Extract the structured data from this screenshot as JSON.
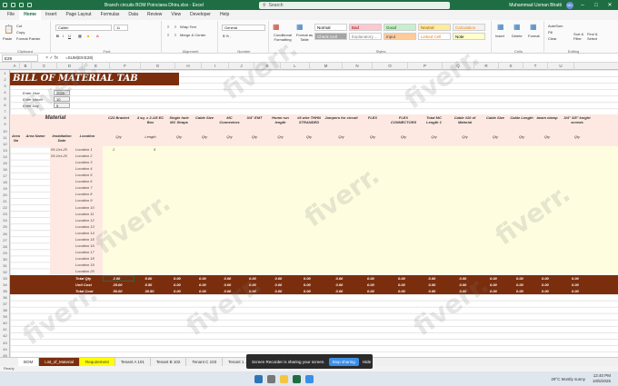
{
  "window": {
    "file_title": "Branch circuits BOM Poinciana  Dhiru.xlsx  -  Excel",
    "search_placeholder": "Search",
    "user_name": "Muhammad Usman Bhatti",
    "user_initials": "MU"
  },
  "menu": [
    "File",
    "Home",
    "Insert",
    "Page Layout",
    "Formulas",
    "Data",
    "Review",
    "View",
    "Developer",
    "Help"
  ],
  "ribbon": {
    "clipboard": {
      "paste": "Paste",
      "cut": "Cut",
      "copy": "Copy",
      "format_painter": "Format Painter",
      "label": "Clipboard"
    },
    "font": {
      "name": "Calibri",
      "size": "11",
      "label": "Font"
    },
    "alignment": {
      "wrap": "Wrap Text",
      "merge": "Merge & Center",
      "label": "Alignment"
    },
    "number": {
      "format": "General",
      "label": "Number"
    },
    "styles": {
      "conditional": "Conditional Formatting",
      "format_table": "Format as Table",
      "cells": [
        {
          "text": "Normal",
          "bg": "#ffffff",
          "fg": "#000000"
        },
        {
          "text": "Bad",
          "bg": "#ffc7ce",
          "fg": "#9c0006"
        },
        {
          "text": "Good",
          "bg": "#c6efce",
          "fg": "#006100"
        },
        {
          "text": "Neutral",
          "bg": "#ffeb9c",
          "fg": "#9c5700"
        },
        {
          "text": "Calculation",
          "bg": "#f2f2f2",
          "fg": "#fa7d00"
        },
        {
          "text": "Check Cell",
          "bg": "#a5a5a5",
          "fg": "#ffffff"
        },
        {
          "text": "Explanatory ...",
          "bg": "#ffffff",
          "fg": "#7f7f7f"
        },
        {
          "text": "Input",
          "bg": "#ffcc99",
          "fg": "#3f3f76"
        },
        {
          "text": "Linked Cell",
          "bg": "#ffffff",
          "fg": "#fa7d00"
        },
        {
          "text": "Note",
          "bg": "#ffffcc",
          "fg": "#000000"
        }
      ],
      "label": "Styles"
    },
    "cells": {
      "insert": "Insert",
      "delete": "Delete",
      "format": "Format",
      "label": "Cells"
    },
    "editing": {
      "autosum": "AutoSum",
      "fill": "Fill",
      "clear": "Clear",
      "sort": "Sort & Filter",
      "find": "Find & Select",
      "label": "Editing"
    }
  },
  "formula_bar": {
    "name_box": "E29",
    "formula": "=SUM(E9:E28)"
  },
  "columns": [
    "A",
    "B",
    "C",
    "D",
    "E",
    "F",
    "G",
    "H",
    "I",
    "J",
    "K",
    "L",
    "M",
    "N",
    "O",
    "P",
    "Q",
    "R",
    "S",
    "T",
    "U"
  ],
  "rows": [
    "1",
    "2",
    "3",
    "4",
    "5",
    "6",
    "7",
    "8",
    "9",
    "10",
    "11",
    "12",
    "13",
    "14",
    "15",
    "16",
    "17",
    "18",
    "19",
    "20",
    "21",
    "22",
    "23",
    "24",
    "25",
    "26",
    "27",
    "28",
    "29",
    "30",
    "31",
    "32",
    "33",
    "34",
    "35",
    "36",
    "37",
    "38",
    "39",
    "40",
    "41",
    "42",
    "43",
    "44",
    "45"
  ],
  "sheet": {
    "title": "BILL OF MATERIAL TAB",
    "enter_year_label": "Enter Year",
    "enter_year": "2025",
    "enter_month_label": "Enter Month",
    "enter_month": "10",
    "enter_day_label": "Enter Day",
    "enter_day": "5",
    "material_label": "Material",
    "fixed_headers": [
      "Area No",
      "Area Name",
      "Installation Date",
      "Location"
    ],
    "item_headers": [
      {
        "name": "C23 Bracket",
        "unit": "Qty"
      },
      {
        "name": "4 sq. x 2-1/8 EC Box",
        "unit": "Length"
      },
      {
        "name": "Single hole MC Straps",
        "unit": "Qty"
      },
      {
        "name": "Cable Size",
        "unit": "Qty"
      },
      {
        "name": "MC Connectors",
        "unit": "Qty"
      },
      {
        "name": "3/4\" EMT",
        "unit": "Qty"
      },
      {
        "name": "Home run length",
        "unit": "Qty"
      },
      {
        "name": "#6 wire THHN STRANDED",
        "unit": "Qty"
      },
      {
        "name": "Jumpers for circuit",
        "unit": "Qty"
      },
      {
        "name": "FLEX",
        "unit": "Qty"
      },
      {
        "name": "FLEX CONNECTORS",
        "unit": "Qty"
      },
      {
        "name": "Total MC Length 1",
        "unit": "Qty"
      },
      {
        "name": "Cable #10 of Material",
        "unit": "Qty"
      },
      {
        "name": "Cable Size",
        "unit": "Qty"
      },
      {
        "name": "Cable Length",
        "unit": "Qty"
      },
      {
        "name": "beam clamp",
        "unit": "Qty"
      },
      {
        "name": "3/4\" 3/8\" knight screws",
        "unit": "Qty"
      }
    ],
    "dates": [
      "05-Oct-25",
      "05-Oct-25"
    ],
    "first_values": [
      "2",
      "5"
    ],
    "locations": [
      "Location 1",
      "Location 2",
      "Location 3",
      "Location 4",
      "Location 5",
      "Location 6",
      "Location 7",
      "Location 8",
      "Location 9",
      "Location 10",
      "Location 11",
      "Location 12",
      "Location 13",
      "Location 14",
      "Location 15",
      "Location 16",
      "Location 17",
      "Location 18",
      "Location 19",
      "Location 20"
    ],
    "totals": [
      {
        "label": "Total Qty",
        "values": [
          "2.00",
          "5.00",
          "0.00",
          "0.00",
          "0.00",
          "0.00",
          "0.00",
          "0.00",
          "0.00",
          "0.00",
          "0.00",
          "0.00",
          "0.00",
          "0.00",
          "0.00",
          "0.00",
          "0.00"
        ]
      },
      {
        "label": "Unit Cost",
        "values": [
          "25.00",
          "5.50",
          "0.00",
          "0.00",
          "0.00",
          "0.00",
          "0.00",
          "0.00",
          "0.00",
          "0.00",
          "0.00",
          "0.00",
          "0.00",
          "0.00",
          "0.00",
          "0.00",
          "0.00"
        ]
      },
      {
        "label": "Total Cost",
        "values": [
          "50.00",
          "30.50",
          "0.00",
          "0.00",
          "0.00",
          "0.00",
          "0.00",
          "0.00",
          "0.00",
          "0.00",
          "0.00",
          "0.00",
          "0.00",
          "0.00",
          "0.00",
          "0.00",
          "0.00"
        ]
      }
    ]
  },
  "sheet_tabs": [
    {
      "name": "BOM",
      "color": "#ffffff"
    },
    {
      "name": "List_of_Material",
      "color": "#7b2e0e"
    },
    {
      "name": "Requirement",
      "color": "#ffff00"
    },
    {
      "name": "Tenant A 101",
      "color": "#f0f0f0"
    },
    {
      "name": "Tenant B 102",
      "color": "#f0f0f0"
    },
    {
      "name": "Tenant C 103",
      "color": "#f0f0f0"
    },
    {
      "name": "Tenant 1 ...",
      "color": "#f0f0f0"
    },
    {
      "name": "111",
      "color": "#f0f0f0"
    },
    {
      "name": "BOM_",
      "color": "#f0f0f0"
    }
  ],
  "status": {
    "ready": "Ready"
  },
  "toast": {
    "text": "Screen Recorder is sharing your screen.",
    "stop": "Stop sharing",
    "hide": "Hide"
  },
  "taskbar": {
    "weather": "29°C  Mostly sunny",
    "time": "12:40 PM",
    "date": "10/5/2025"
  },
  "watermark": "fiverr."
}
